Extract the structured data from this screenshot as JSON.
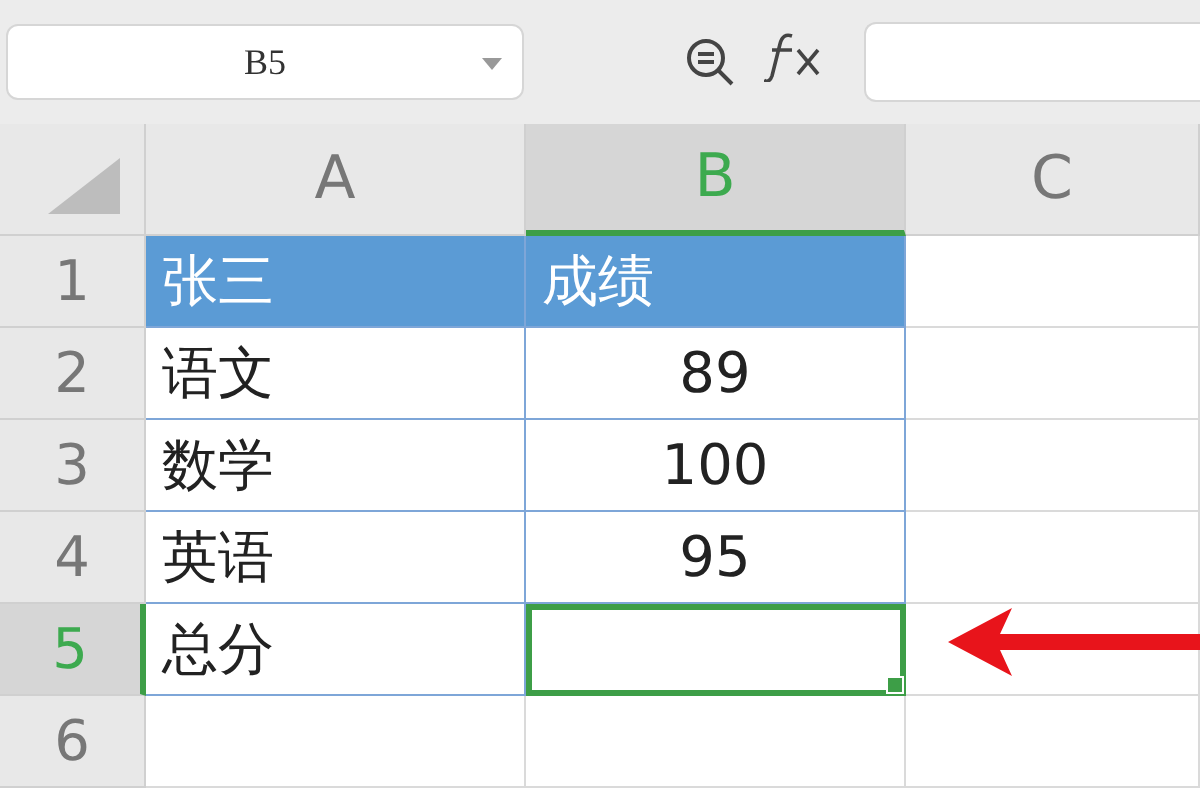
{
  "name_box": {
    "value": "B5"
  },
  "columns": [
    {
      "label": "A",
      "selected": false
    },
    {
      "label": "B",
      "selected": true
    },
    {
      "label": "C",
      "selected": false
    }
  ],
  "rows": [
    {
      "number": "1",
      "selected": false,
      "kind": "header",
      "cells": [
        {
          "text": "张三",
          "selected": false
        },
        {
          "text": "成绩",
          "selected": false
        }
      ]
    },
    {
      "number": "2",
      "selected": false,
      "kind": "data",
      "cells": [
        {
          "text": "语文",
          "selected": false
        },
        {
          "text": "89",
          "selected": false
        }
      ]
    },
    {
      "number": "3",
      "selected": false,
      "kind": "data",
      "cells": [
        {
          "text": "数学",
          "selected": false
        },
        {
          "text": "100",
          "selected": false
        }
      ]
    },
    {
      "number": "4",
      "selected": false,
      "kind": "data",
      "cells": [
        {
          "text": "英语",
          "selected": false
        },
        {
          "text": "95",
          "selected": false
        }
      ]
    },
    {
      "number": "5",
      "selected": true,
      "kind": "data",
      "cells": [
        {
          "text": "总分",
          "selected": false
        },
        {
          "selected": true
        }
      ]
    },
    {
      "number": "6",
      "selected": false,
      "kind": "empty",
      "cells": []
    }
  ],
  "annotation": {
    "kind": "arrow"
  }
}
